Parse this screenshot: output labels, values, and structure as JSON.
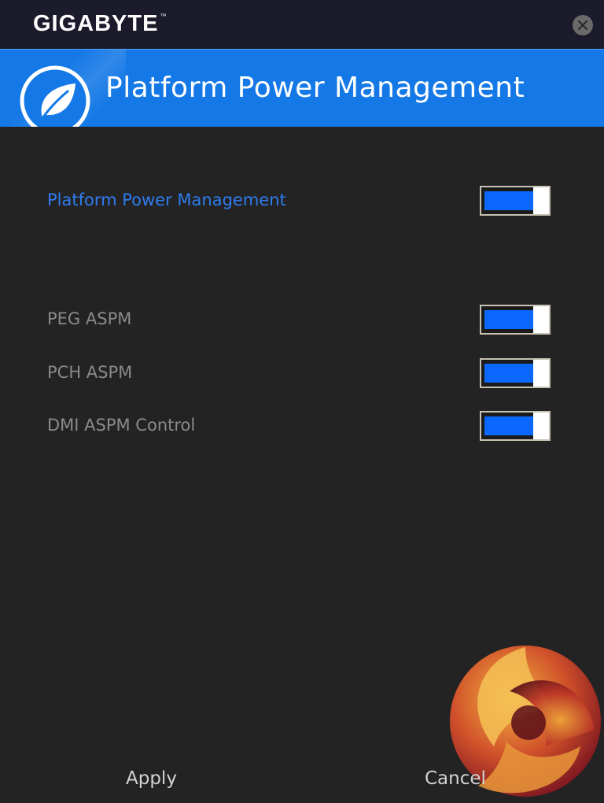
{
  "app": {
    "brand": "GIGABYTE",
    "trademark": "™"
  },
  "header": {
    "title": "Platform Power Management",
    "icon": "leaf-icon",
    "accent_color": "#1478e6"
  },
  "settings": [
    {
      "label": "Platform Power Management",
      "enabled": true,
      "primary": true
    },
    {
      "label": "PEG ASPM",
      "enabled": true,
      "primary": false
    },
    {
      "label": "PCH ASPM",
      "enabled": true,
      "primary": false
    },
    {
      "label": "DMI ASPM Control",
      "enabled": true,
      "primary": false
    }
  ],
  "footer": {
    "apply_label": "Apply",
    "cancel_label": "Cancel"
  },
  "colors": {
    "background": "#232323",
    "titlebar": "#1b1b2c",
    "toggle_on": "#0a68ff",
    "primary_label": "#2e7cf0",
    "secondary_label": "#8a8a8a"
  }
}
